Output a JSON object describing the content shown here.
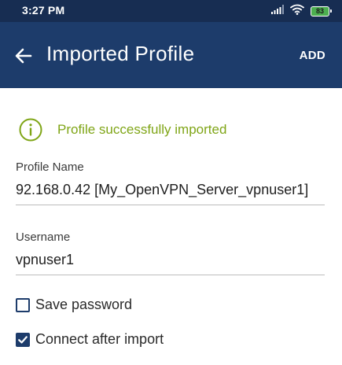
{
  "status_bar": {
    "time": "3:27 PM",
    "battery_level": "83",
    "icons": [
      "signal-icon",
      "wifi-icon",
      "battery-icon"
    ]
  },
  "app_bar": {
    "title": "Imported Profile",
    "back_icon": "arrow-left-icon",
    "action_label": "ADD"
  },
  "message": {
    "icon": "info-circle-icon",
    "text": "Profile successfully imported"
  },
  "form": {
    "profile_name_label": "Profile Name",
    "profile_name_value": "92.168.0.42 [My_OpenVPN_Server_vpnuser1]",
    "username_label": "Username",
    "username_value": "vpnuser1",
    "save_password_label": "Save password",
    "save_password_checked": false,
    "connect_after_import_label": "Connect after import",
    "connect_after_import_checked": true
  },
  "colors": {
    "status_bar": "#172d52",
    "app_bar": "#1d3c6b",
    "success": "#7fa516",
    "checkbox": "#1d3c6b",
    "battery": "#4caf50"
  }
}
